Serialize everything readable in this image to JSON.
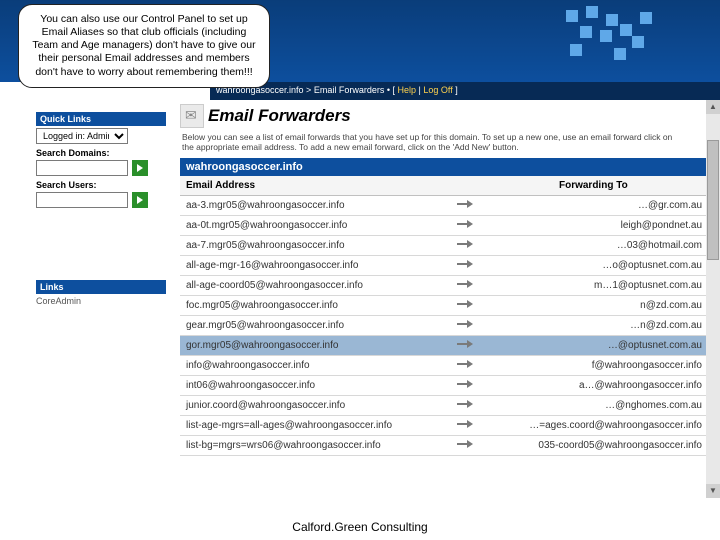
{
  "callout": "You can also use our Control Panel to set up Email Aliases so that club officials (including Team and Age managers) don't have to give our their personal Email addresses and members don't have to worry about remembering them!!!",
  "breadcrumb": {
    "path": "wahroongasoccer.info > Email Forwarders • [",
    "help": "Help",
    "sep": " | ",
    "logoff": "Log Off",
    "end": " ]"
  },
  "sidebar": {
    "quick_links_hdr": "Quick Links",
    "logged_in_label": "Logged in: Admin",
    "search_domains": "Search Domains:",
    "search_users": "Search Users:",
    "links_hdr": "Links",
    "link1": "CoreAdmin"
  },
  "page": {
    "title": "Email Forwarders",
    "intro": "Below you can see a list of email forwards that you have set up for this domain. To set up a new one, use an email forward click on the appropriate email address. To add a new email forward, click on the 'Add New' button."
  },
  "domain_bar": "wahroongasoccer.info",
  "table": {
    "col1": "Email Address",
    "col2": "Forwarding To",
    "rows": [
      {
        "a": "aa-3.mgr05@wahroongasoccer.info",
        "b": "…@gr.com.au",
        "sel": false
      },
      {
        "a": "aa-0t.mgr05@wahroongasoccer.info",
        "b": "leigh@pondnet.au",
        "sel": false
      },
      {
        "a": "aa-7.mgr05@wahroongasoccer.info",
        "b": "…03@hotmail.com",
        "sel": false
      },
      {
        "a": "all-age-mgr-16@wahroongasoccer.info",
        "b": "…o@optusnet.com.au",
        "sel": false
      },
      {
        "a": "all-age-coord05@wahroongasoccer.info",
        "b": "m…1@optusnet.com.au",
        "sel": false
      },
      {
        "a": "foc.mgr05@wahroongasoccer.info",
        "b": "n@zd.com.au",
        "sel": false
      },
      {
        "a": "gear.mgr05@wahroongasoccer.info",
        "b": "…n@zd.com.au",
        "sel": false
      },
      {
        "a": "gor.mgr05@wahroongasoccer.info",
        "b": "…@optusnet.com.au",
        "sel": true
      },
      {
        "a": "info@wahroongasoccer.info",
        "b": "f@wahroongasoccer.info",
        "sel": false
      },
      {
        "a": "int06@wahroongasoccer.info",
        "b": "a…@wahroongasoccer.info",
        "sel": false
      },
      {
        "a": "junior.coord@wahroongasoccer.info",
        "b": "…@nghomes.com.au",
        "sel": false
      },
      {
        "a": "list-age-mgrs=all-ages@wahroongasoccer.info",
        "b": "…=ages.coord@wahroongasoccer.info",
        "sel": false
      },
      {
        "a": "list-bg=mgrs=wrs06@wahroongasoccer.info",
        "b": "035-coord05@wahroongasoccer.info",
        "sel": false
      }
    ]
  },
  "footer": "Calford.Green Consulting"
}
